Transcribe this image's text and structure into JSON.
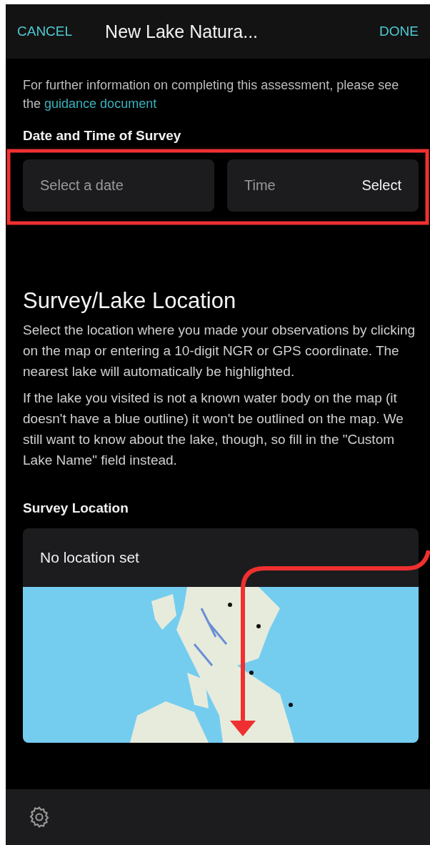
{
  "header": {
    "cancel": "CANCEL",
    "title": "New Lake Natura...",
    "done": "DONE"
  },
  "intro": {
    "text": "For further information on completing this assessment, please see the",
    "link": "guidance document"
  },
  "date_time": {
    "label": "Date and Time of Survey",
    "date_placeholder": "Select a date",
    "time_placeholder": "Time",
    "time_action": "Select"
  },
  "location_section": {
    "heading": "Survey/Lake Location",
    "paragraphs": [
      "Select the location where you made your observations by clicking on the map or entering a 10-digit NGR or GPS coordinate. The nearest lake will automatically be highlighted.",
      "If the lake you visited is not a known water body on the map (it doesn't have a blue outline) it won't be outlined on the map. We still want to know about the lake, though, so fill in the \"Custom Lake Name\" field instead."
    ]
  },
  "survey_location": {
    "label": "Survey Location",
    "status": "No location set"
  }
}
